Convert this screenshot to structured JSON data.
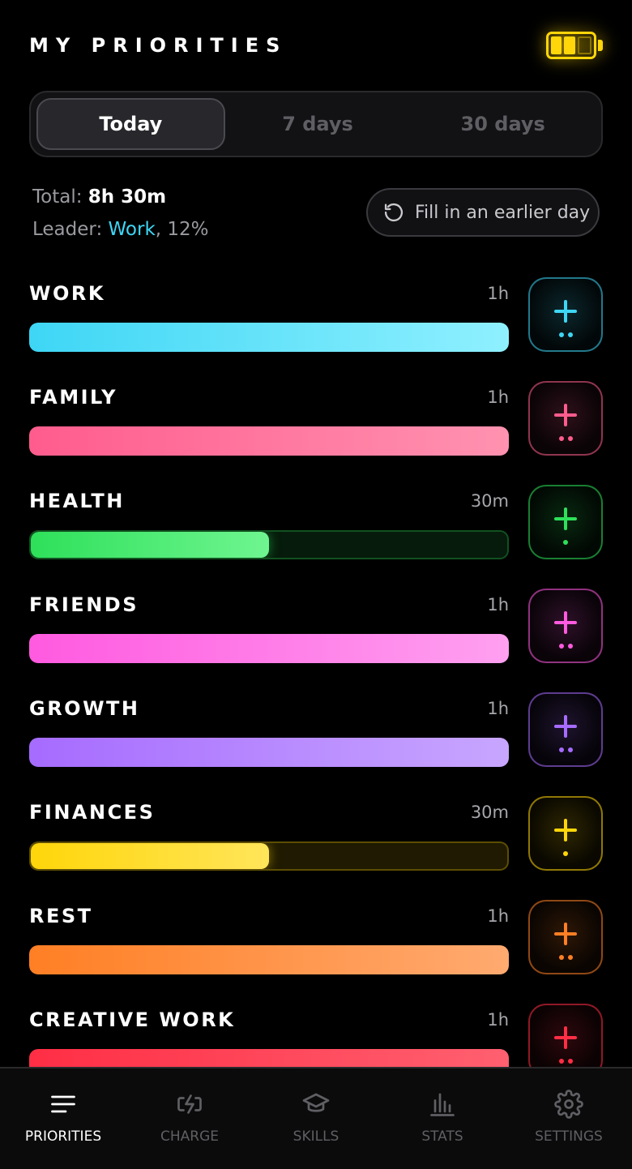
{
  "header": {
    "title": "MY PRIORITIES",
    "battery_icon": "battery-icon",
    "battery_level": "2/3",
    "battery_color": "#ffd60a"
  },
  "range_tabs": [
    {
      "label": "Today",
      "active": true
    },
    {
      "label": "7 days",
      "active": false
    },
    {
      "label": "30 days",
      "active": false
    }
  ],
  "summary": {
    "total_label": "Total:",
    "total_value": "8h 30m",
    "leader_label": "Leader:",
    "leader_name": "Work",
    "leader_pct": ", 12%"
  },
  "fill_button": {
    "label": "Fill in an earlier day",
    "icon": "history-icon"
  },
  "priorities": [
    {
      "name": "WORK",
      "time": "1h",
      "progress": 1.0,
      "color": "#3ed6f5",
      "color_light": "#8ff0ff",
      "dots": 2
    },
    {
      "name": "FAMILY",
      "time": "1h",
      "progress": 1.0,
      "color": "#ff5c8d",
      "color_light": "#ff92b0",
      "dots": 2
    },
    {
      "name": "HEALTH",
      "time": "30m",
      "progress": 0.5,
      "color": "#2ee05a",
      "color_light": "#6ff590",
      "dots": 1
    },
    {
      "name": "FRIENDS",
      "time": "1h",
      "progress": 1.0,
      "color": "#ff5ae0",
      "color_light": "#ffa0f0",
      "dots": 2
    },
    {
      "name": "GROWTH",
      "time": "1h",
      "progress": 1.0,
      "color": "#a66bff",
      "color_light": "#c8a6ff",
      "dots": 2
    },
    {
      "name": "FINANCES",
      "time": "30m",
      "progress": 0.5,
      "color": "#ffd60a",
      "color_light": "#ffe55a",
      "dots": 1
    },
    {
      "name": "REST",
      "time": "1h",
      "progress": 1.0,
      "color": "#ff7f24",
      "color_light": "#ffaa70",
      "dots": 2
    },
    {
      "name": "CREATIVE WORK",
      "time": "1h",
      "progress": 1.0,
      "color": "#ff2e45",
      "color_light": "#ff6070",
      "dots": 2
    }
  ],
  "nav": [
    {
      "label": "PRIORITIES",
      "icon": "menu-lines-icon",
      "active": true
    },
    {
      "label": "CHARGE",
      "icon": "charge-bolt-icon",
      "active": false
    },
    {
      "label": "SKILLS",
      "icon": "graduation-cap-icon",
      "active": false
    },
    {
      "label": "STATS",
      "icon": "bar-chart-icon",
      "active": false
    },
    {
      "label": "SETTINGS",
      "icon": "gear-icon",
      "active": false
    }
  ]
}
